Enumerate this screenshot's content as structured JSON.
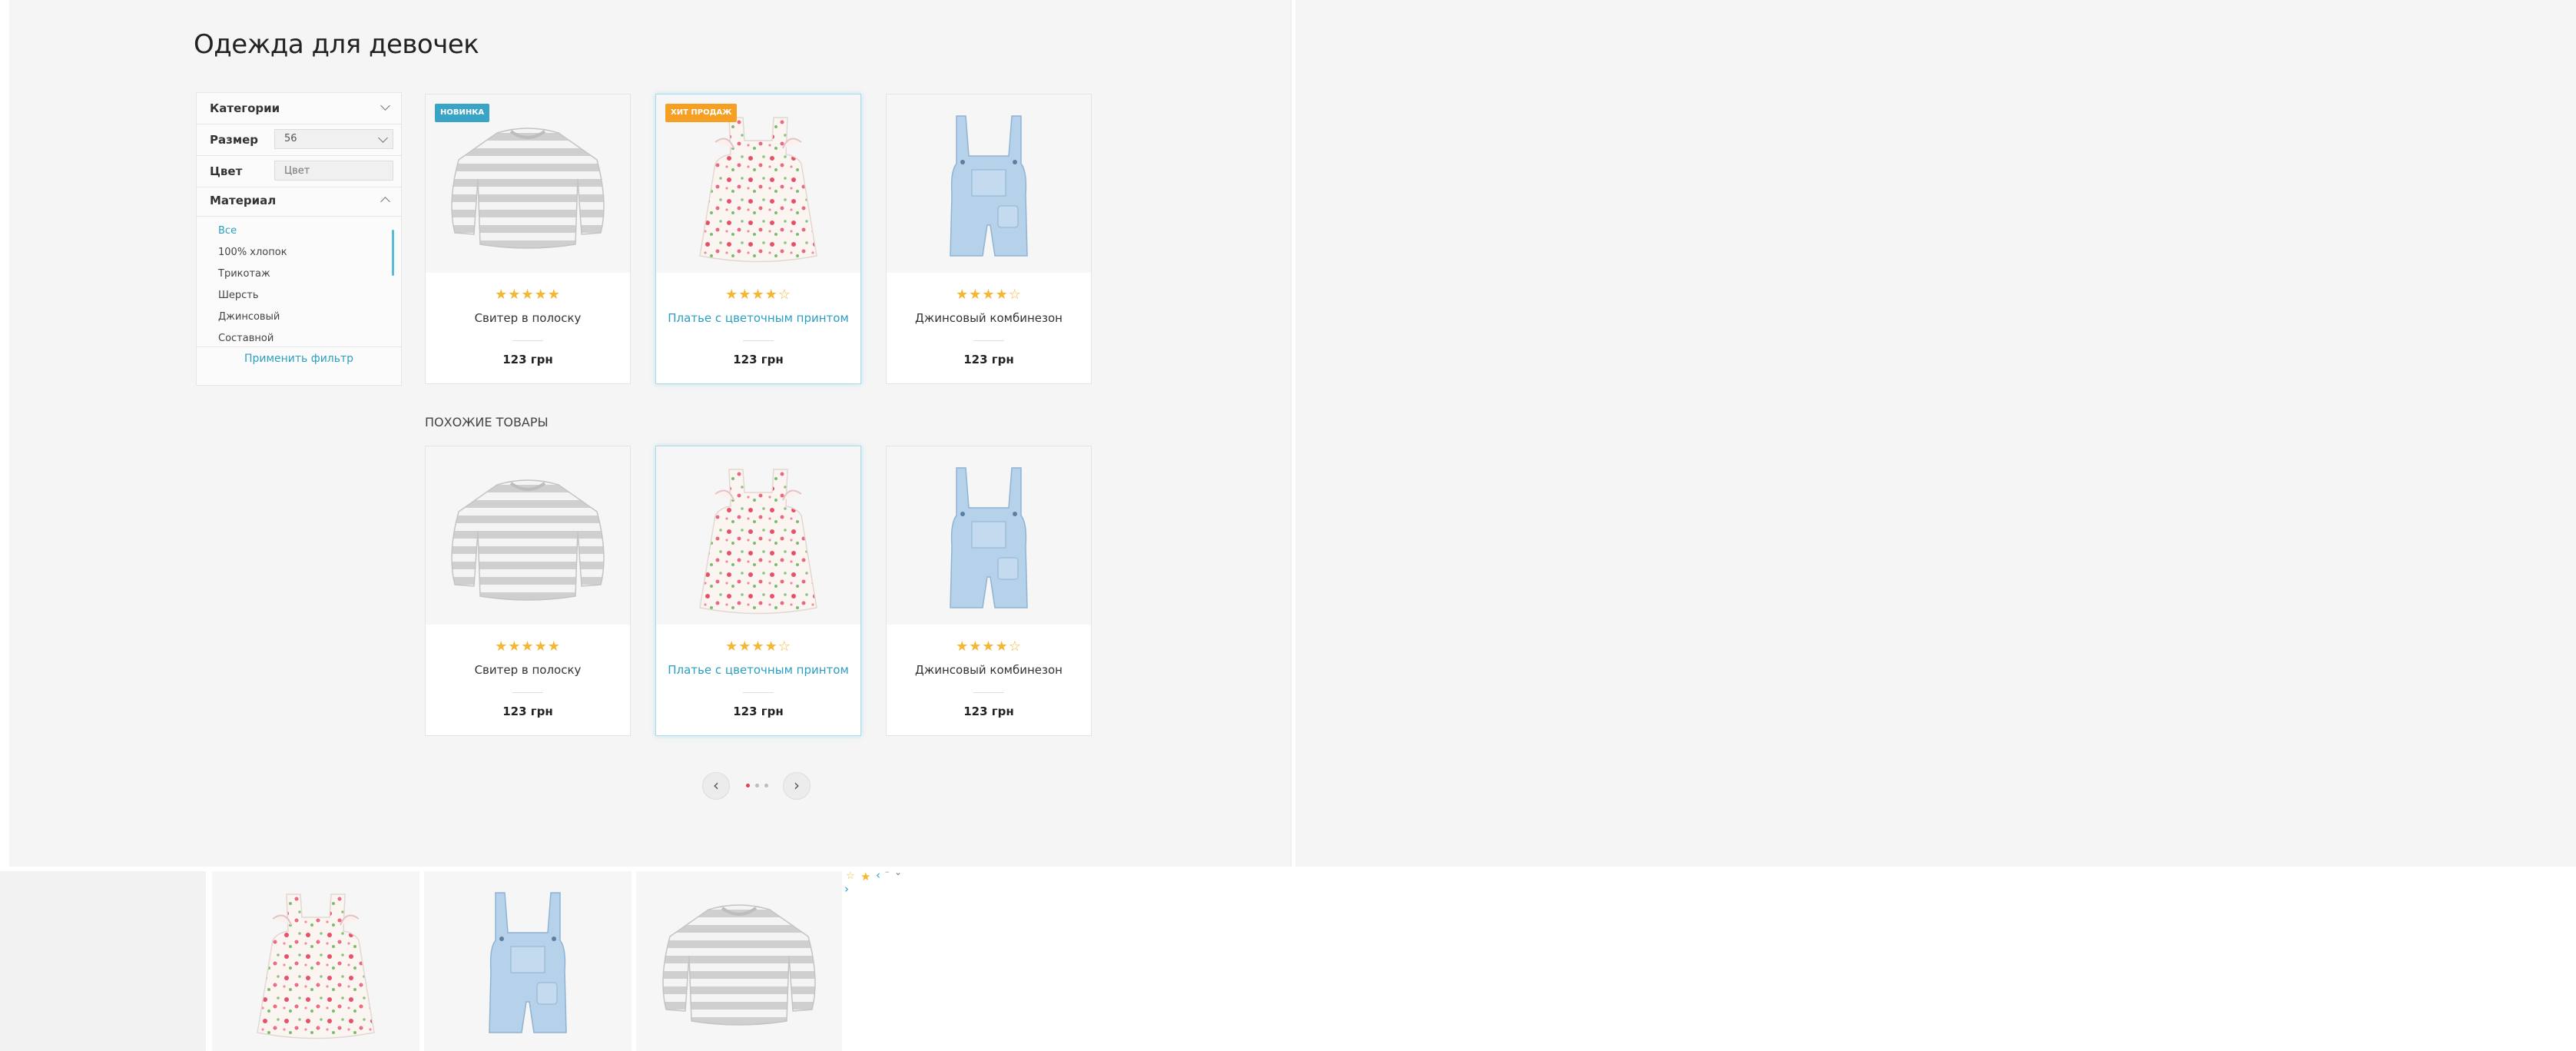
{
  "page": {
    "title": "Одежда для девочек"
  },
  "filter": {
    "categories_label": "Категории",
    "size_label": "Размер",
    "size_value": "56",
    "color_label": "Цвет",
    "color_placeholder": "Цвет",
    "material_label": "Материал",
    "materials": [
      "Все",
      "100% хлопок",
      "Трикотаж",
      "Шерсть",
      "Джинсовый",
      "Составной"
    ],
    "selected_material": "Все",
    "apply_label": "Применить фильтр"
  },
  "products": [
    {
      "name": "Свитер в полоску",
      "price": "123 грн",
      "rating": 5,
      "stars": "★★★★★",
      "badge": "НОВИНКА",
      "image": "striped-sweater"
    },
    {
      "name": "Платье с цветочным принтом",
      "price": "123 грн",
      "rating": 4,
      "stars": "★★★★☆",
      "badge": "ХИТ ПРОДАЖ",
      "image": "floral-dress"
    },
    {
      "name": "Джинсовый комбинезон",
      "price": "123 грн",
      "rating": 4,
      "stars": "★★★★☆",
      "badge": "",
      "image": "denim-overalls"
    }
  ],
  "similar": {
    "title": "ПОХОЖИЕ ТОВАРЫ",
    "items": [
      {
        "name": "Свитер в полоску",
        "price": "123 грн",
        "rating": 5,
        "stars": "★★★★★",
        "image": "striped-sweater"
      },
      {
        "name": "Платье с цветочным принтом",
        "price": "123 грн",
        "rating": 4,
        "stars": "★★★★☆",
        "image": "floral-dress"
      },
      {
        "name": "Джинсовый комбинезон",
        "price": "123 грн",
        "rating": 4,
        "stars": "★★★★☆",
        "image": "denim-overalls"
      }
    ]
  },
  "pagination": {
    "prev": "‹",
    "next": "›",
    "pages": 3,
    "active": 1
  },
  "bottom_strip": {
    "images": [
      "floral-dress",
      "denim-overalls",
      "striped-sweater"
    ],
    "sprites": {
      "star_empty": "☆",
      "star_full": "★",
      "arrow_left": "‹",
      "dash": "–",
      "chevron": "⌄",
      "arrow_right": "›"
    }
  },
  "colors": {
    "accent": "#2b9fc2",
    "star": "#f5b731",
    "badge_new": "#3aa4c6",
    "badge_hit": "#f6a023",
    "active_dot": "#e0405a"
  }
}
